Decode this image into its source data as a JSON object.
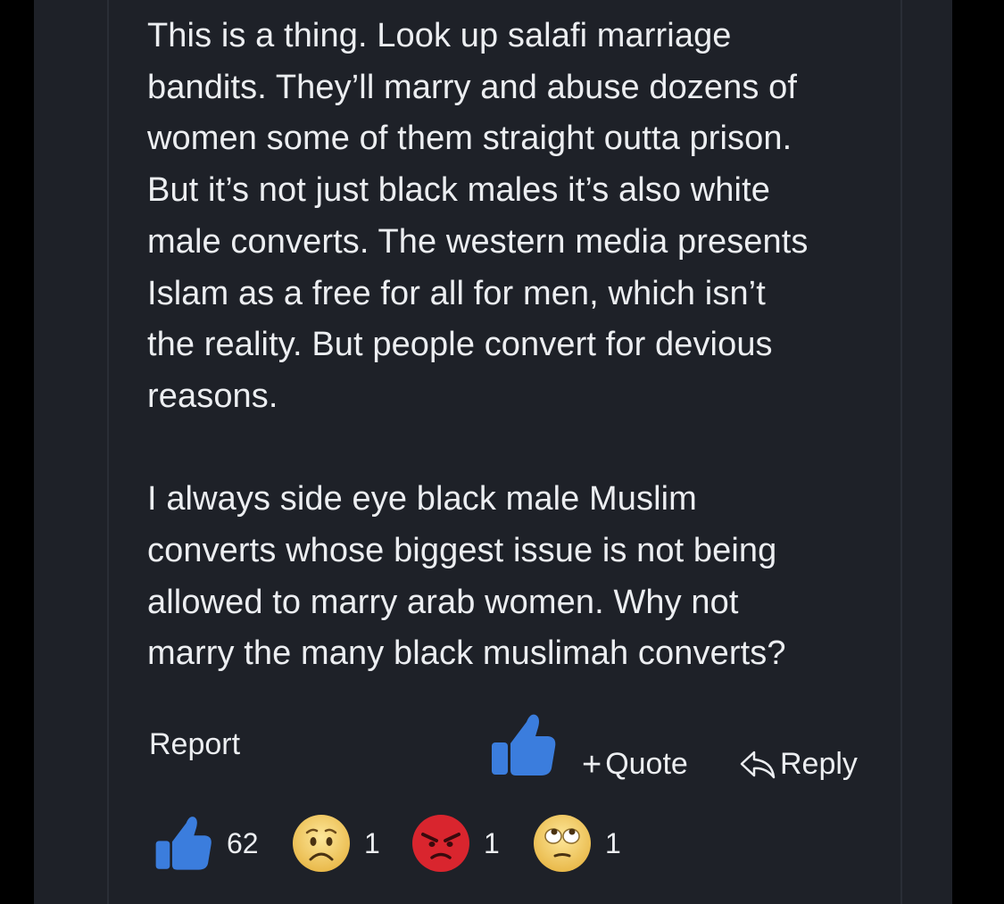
{
  "post": {
    "paragraphs": [
      "This is a thing. Look up salafi marriage\nbandits. They’ll marry and abuse dozens of\nwomen some of them straight outta prison.\nBut it’s not just black males it’s also white\nmale converts. The western media presents\nIslam as a free for all for men, which isn’t\nthe reality. But people convert for devious\nreasons.",
      "I always side eye black male Muslim\nconverts whose biggest issue is not being\nallowed to marry arab women. Why not\nmarry the many black muslimah converts?"
    ]
  },
  "actions": {
    "report_label": "Report",
    "like_icon": "thumbs-up-icon",
    "quote_label": "Quote",
    "quote_icon": "plus-icon",
    "reply_label": "Reply",
    "reply_icon": "reply-arrow-icon"
  },
  "reactions": [
    {
      "icon": "thumbs-up-icon",
      "count": "62"
    },
    {
      "icon": "worried-face-icon",
      "count": "1"
    },
    {
      "icon": "angry-face-icon",
      "count": "1"
    },
    {
      "icon": "eye-roll-face-icon",
      "count": "1"
    }
  ],
  "colors": {
    "panel_bg": "#1e2128",
    "text": "#eceef1",
    "like_blue": "#3b7ddd",
    "angry_red": "#d9252e",
    "emoji_yellow": "#f6cf5e"
  }
}
